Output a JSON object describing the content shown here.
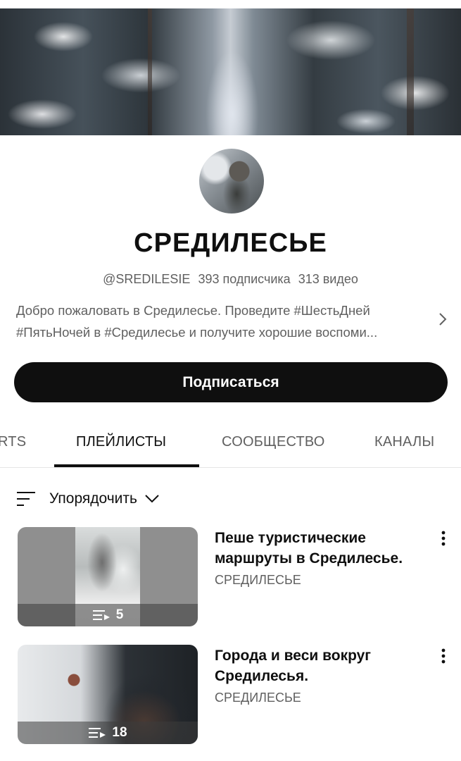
{
  "channel": {
    "name": "СРЕДИЛЕСЬЕ",
    "handle": "@SREDILESIE",
    "subscribers": "393 подписчика",
    "videos": "313 видео",
    "description_line1": "Добро пожаловать в Средилесье. Проведите #ШестьДней",
    "description_line2": "#ПятьНочей в #Средилесье и получите хорошие воспоми...",
    "subscribe_label": "Подписаться"
  },
  "tabs": [
    {
      "label": "RTS",
      "active": false
    },
    {
      "label": "ПЛЕЙЛИСТЫ",
      "active": true
    },
    {
      "label": "СООБЩЕСТВО",
      "active": false
    },
    {
      "label": "КАНАЛЫ",
      "active": false
    }
  ],
  "sort": {
    "label": "Упорядочить"
  },
  "playlists": [
    {
      "title_line1": "Пеше туристические",
      "title_line2": "маршруты в Средилесье.",
      "owner": "СРЕДИЛЕСЬЕ",
      "count": "5"
    },
    {
      "title_line1": "Города и веси вокруг",
      "title_line2": "Средилесья.",
      "owner": "СРЕДИЛЕСЬЕ",
      "count": "18"
    }
  ],
  "icons": {
    "description_more": "chevron-right-icon",
    "sort": "sort-lines-icon",
    "sort_dropdown": "chevron-down-icon",
    "playlist_badge": "playlist-icon",
    "more": "more-vertical-icon"
  }
}
